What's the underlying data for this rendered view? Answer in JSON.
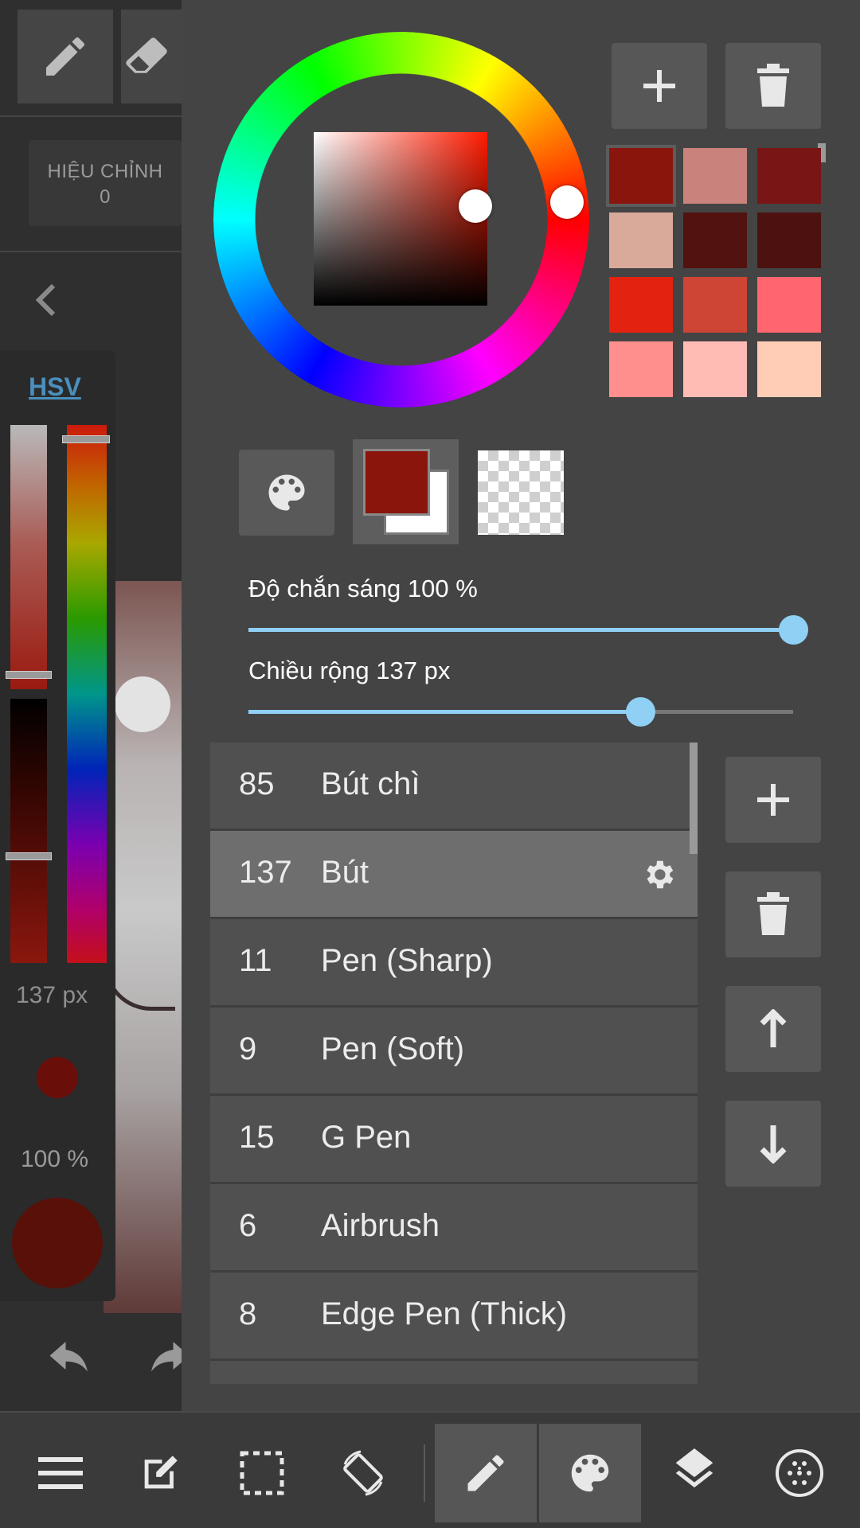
{
  "left": {
    "adjust_label": "HIỆU CHỈNH",
    "adjust_value": "0",
    "color_mode": "HSV",
    "brush_size_readout": "137 px",
    "opacity_readout": "100 %"
  },
  "sliders": {
    "opacity_label": "Độ chắn sáng 100 %",
    "opacity_value": 100,
    "width_label": "Chiều rộng 137 px",
    "width_value_fraction": 0.72
  },
  "colors": {
    "current": "#8a150d",
    "accent": "#8fd0f4",
    "swatches": [
      "#8a150d",
      "#c9827c",
      "#7a1515",
      "#d9aa99",
      "#521210",
      "#4d1210",
      "#e32210",
      "#cf4535",
      "#ff6670",
      "#ff8f8c",
      "#ffbcb5",
      "#ffcdb5"
    ]
  },
  "brushes": [
    {
      "num": "85",
      "name": "Bút chì"
    },
    {
      "num": "137",
      "name": "Bút"
    },
    {
      "num": "11",
      "name": "Pen (Sharp)"
    },
    {
      "num": "9",
      "name": "Pen (Soft)"
    },
    {
      "num": "15",
      "name": "G Pen"
    },
    {
      "num": "6",
      "name": "Airbrush"
    },
    {
      "num": "8",
      "name": "Edge Pen (Thick)"
    }
  ],
  "icons": {
    "palette_add": "plus-icon",
    "palette_delete": "trash-icon",
    "brush_add": "plus-icon",
    "brush_delete": "trash-icon",
    "move_up": "arrow-up-icon",
    "move_down": "arrow-down-icon",
    "toolbar": [
      "menu-icon",
      "edit-icon",
      "selection-icon",
      "rotate-icon",
      "pen-icon",
      "palette-icon",
      "layers-icon",
      "grid-icon"
    ]
  }
}
